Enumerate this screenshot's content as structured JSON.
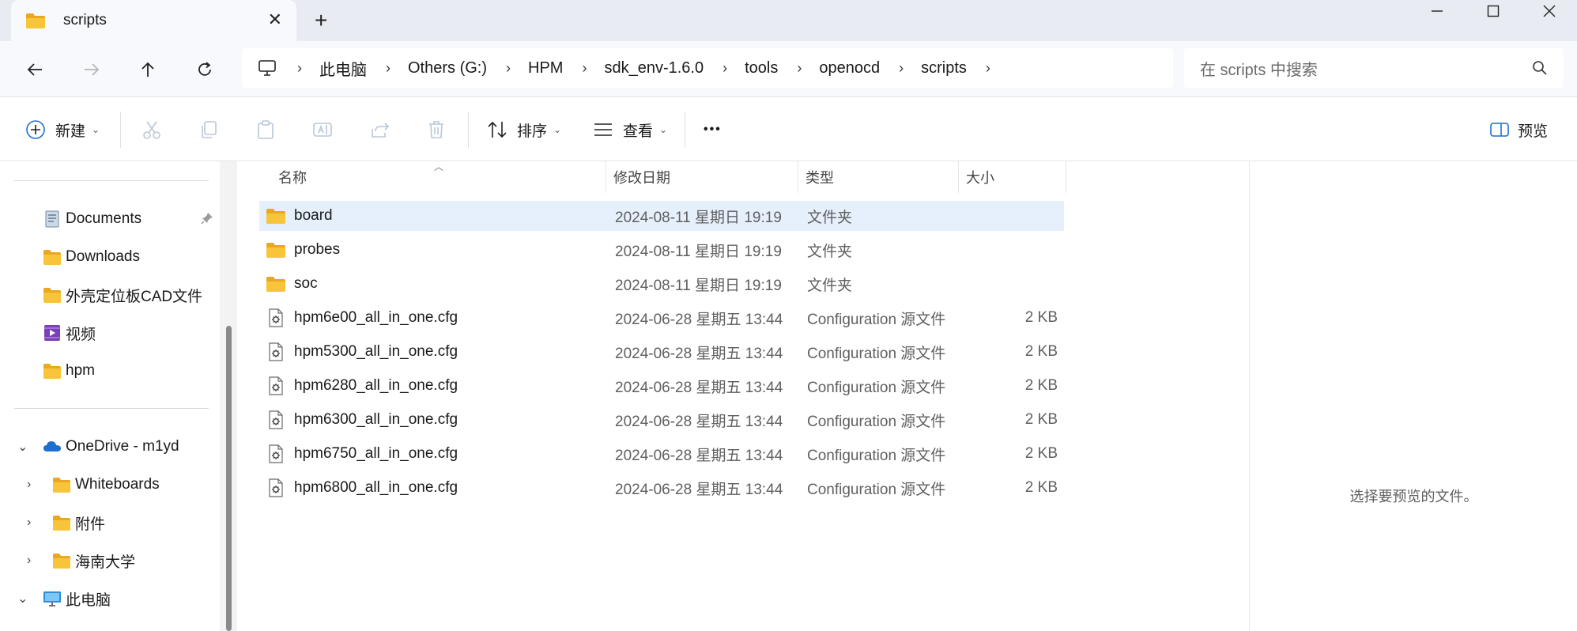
{
  "tab": {
    "title": "scripts",
    "close_glyph": "✕",
    "new_tab_glyph": "+"
  },
  "window_controls": {
    "minimize": "—",
    "maximize": "☐",
    "close": "✕"
  },
  "breadcrumb": {
    "items": [
      "此电脑",
      "Others (G:)",
      "HPM",
      "sdk_env-1.6.0",
      "tools",
      "openocd",
      "scripts"
    ],
    "separator": "›"
  },
  "search": {
    "placeholder": "在 scripts 中搜索"
  },
  "toolbar": {
    "new_label": "新建",
    "sort_label": "排序",
    "view_label": "查看",
    "more_label": "•••",
    "preview_label": "预览"
  },
  "sidebar": {
    "quick_access": [
      {
        "label": "Documents",
        "icon": "document-icon",
        "pinned": true
      },
      {
        "label": "Downloads",
        "icon": "folder-icon"
      },
      {
        "label": "外壳定位板CAD文件",
        "icon": "folder-icon"
      },
      {
        "label": "视频",
        "icon": "video-icon"
      },
      {
        "label": "hpm",
        "icon": "folder-icon"
      }
    ],
    "onedrive": {
      "label": "OneDrive - m1yd",
      "children": [
        "Whiteboards",
        "附件",
        "海南大学"
      ]
    },
    "this_pc": {
      "label": "此电脑"
    }
  },
  "columns": {
    "name": "名称",
    "date": "修改日期",
    "type": "类型",
    "size": "大小"
  },
  "files": [
    {
      "name": "board",
      "date": "2024-08-11 星期日 19:19",
      "type": "文件夹",
      "size": "",
      "kind": "folder",
      "selected": true
    },
    {
      "name": "probes",
      "date": "2024-08-11 星期日 19:19",
      "type": "文件夹",
      "size": "",
      "kind": "folder"
    },
    {
      "name": "soc",
      "date": "2024-08-11 星期日 19:19",
      "type": "文件夹",
      "size": "",
      "kind": "folder"
    },
    {
      "name": "hpm6e00_all_in_one.cfg",
      "date": "2024-06-28 星期五 13:44",
      "type": "Configuration 源文件",
      "size": "2 KB",
      "kind": "cfg"
    },
    {
      "name": "hpm5300_all_in_one.cfg",
      "date": "2024-06-28 星期五 13:44",
      "type": "Configuration 源文件",
      "size": "2 KB",
      "kind": "cfg"
    },
    {
      "name": "hpm6280_all_in_one.cfg",
      "date": "2024-06-28 星期五 13:44",
      "type": "Configuration 源文件",
      "size": "2 KB",
      "kind": "cfg"
    },
    {
      "name": "hpm6300_all_in_one.cfg",
      "date": "2024-06-28 星期五 13:44",
      "type": "Configuration 源文件",
      "size": "2 KB",
      "kind": "cfg"
    },
    {
      "name": "hpm6750_all_in_one.cfg",
      "date": "2024-06-28 星期五 13:44",
      "type": "Configuration 源文件",
      "size": "2 KB",
      "kind": "cfg"
    },
    {
      "name": "hpm6800_all_in_one.cfg",
      "date": "2024-06-28 星期五 13:44",
      "type": "Configuration 源文件",
      "size": "2 KB",
      "kind": "cfg"
    }
  ],
  "preview": {
    "empty_text": "选择要预览的文件。"
  },
  "colors": {
    "folder": "#f8c53a",
    "selection": "#e5f0fc",
    "accent": "#1f6fd1"
  }
}
